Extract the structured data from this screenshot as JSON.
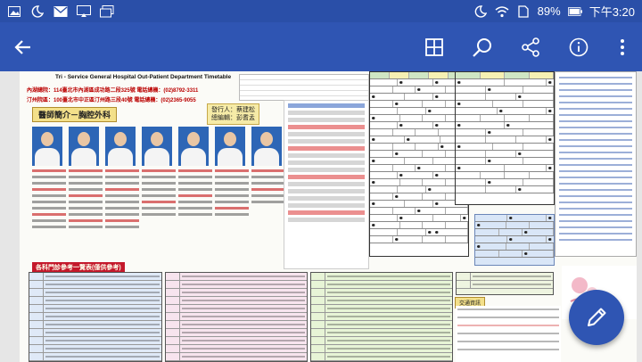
{
  "status_bar": {
    "battery": "89%",
    "time": "下午3:20",
    "left_icons": [
      "photo-icon",
      "moon-notification-icon",
      "mail-icon",
      "cast-icon",
      "screen-icon"
    ],
    "right_icons": [
      "moon-icon",
      "wifi-icon",
      "sim-icon",
      "battery-icon"
    ]
  },
  "app_bar": {
    "back_icon": "arrow-back-icon",
    "actions": [
      "grid-icon",
      "search-icon",
      "share-icon",
      "info-icon",
      "more-vert-icon"
    ]
  },
  "document": {
    "header_title": "Tri - Service General Hospital Out-Patient Department Timetable",
    "address_1": "內湖總院：114臺北市內湖區成功路二段325號  電話總機：(02)8792-3311",
    "address_2": "汀州院區：100臺北市中正區汀州路三段40號  電話總機：(02)2365-9055",
    "section_title": "醫師簡介－胸腔外科",
    "publisher_1": "發行人：蔡建松",
    "publisher_2": "總編輯：彭耆孟",
    "fee_title": "各科門診參考一覽表(僅供參考)",
    "traffic_title": "交通資訊"
  },
  "fab": {
    "icon": "edit-pencil-icon"
  }
}
